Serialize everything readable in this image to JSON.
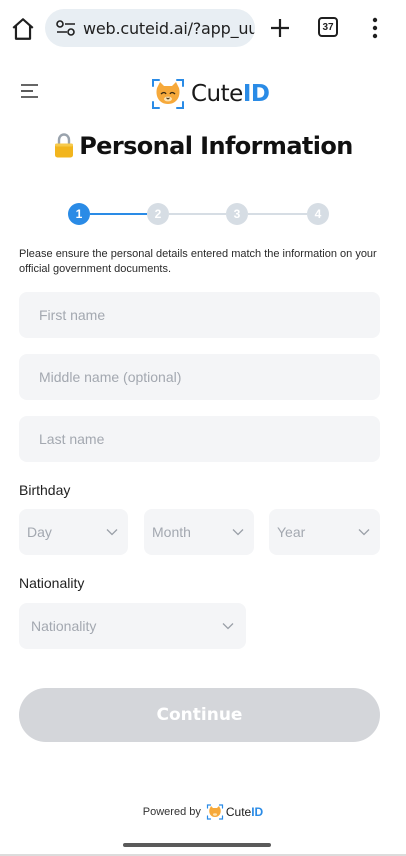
{
  "browser": {
    "url": "web.cuteid.ai/?app_uuid",
    "tab_count": "37"
  },
  "brand": {
    "name_plain": "Cute",
    "name_accent": "ID",
    "accent_color": "#2a8be6"
  },
  "page": {
    "title": "Personal Information",
    "notice": "Please ensure the personal details entered match the information on your official government documents."
  },
  "stepper": {
    "steps": [
      "1",
      "2",
      "3",
      "4"
    ],
    "current": 1
  },
  "form": {
    "first_name_placeholder": "First name",
    "middle_name_placeholder": "Middle name (optional)",
    "last_name_placeholder": "Last name",
    "birthday_label": "Birthday",
    "day_placeholder": "Day",
    "month_placeholder": "Month",
    "year_placeholder": "Year",
    "nationality_label": "Nationality",
    "nationality_placeholder": "Nationality",
    "continue_label": "Continue"
  },
  "footer": {
    "powered_by": "Powered by",
    "brand_plain": "Cute",
    "brand_accent": "ID"
  }
}
